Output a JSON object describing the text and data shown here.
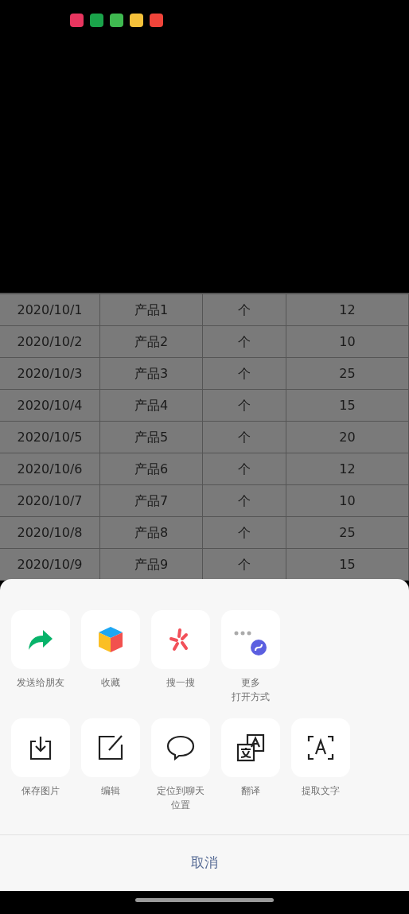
{
  "table": {
    "rows": [
      [
        "2020/10/1",
        "产品1",
        "个",
        "12"
      ],
      [
        "2020/10/2",
        "产品2",
        "个",
        "10"
      ],
      [
        "2020/10/3",
        "产品3",
        "个",
        "25"
      ],
      [
        "2020/10/4",
        "产品4",
        "个",
        "15"
      ],
      [
        "2020/10/5",
        "产品5",
        "个",
        "20"
      ],
      [
        "2020/10/6",
        "产品6",
        "个",
        "12"
      ],
      [
        "2020/10/7",
        "产品7",
        "个",
        "10"
      ],
      [
        "2020/10/8",
        "产品8",
        "个",
        "25"
      ],
      [
        "2020/10/9",
        "产品9",
        "个",
        "15"
      ]
    ]
  },
  "share_sheet": {
    "rows": [
      [
        {
          "kind": "forward",
          "label_lines": [
            "发送给朋友"
          ]
        },
        {
          "kind": "favorite",
          "label_lines": [
            "收藏"
          ]
        },
        {
          "kind": "search",
          "label_lines": [
            "搜一搜"
          ]
        },
        {
          "kind": "more",
          "label_lines": [
            "更多",
            "打开方式"
          ]
        }
      ],
      [
        {
          "kind": "save",
          "label_lines": [
            "保存图片"
          ]
        },
        {
          "kind": "edit",
          "label_lines": [
            "编辑"
          ]
        },
        {
          "kind": "locate",
          "label_lines": [
            "定位到聊天位置"
          ]
        },
        {
          "kind": "translate",
          "label_lines": [
            "翻译"
          ]
        },
        {
          "kind": "extract",
          "label_lines": [
            "提取文字"
          ]
        }
      ]
    ],
    "cancel": "取消"
  }
}
